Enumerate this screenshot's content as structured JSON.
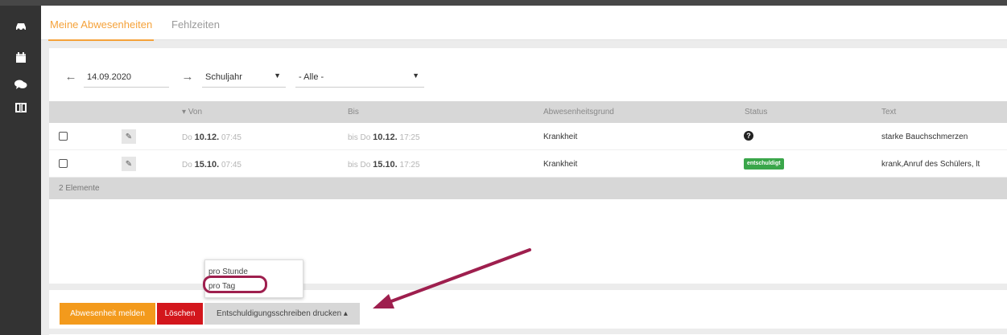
{
  "sidebar": {
    "items": [
      {
        "name": "dashboard-icon",
        "glyph": "🚗"
      },
      {
        "name": "calendar-icon",
        "glyph": "▦"
      },
      {
        "name": "messages-icon",
        "glyph": "💬"
      },
      {
        "name": "book-icon",
        "glyph": "▯"
      }
    ]
  },
  "tabs": {
    "active": "Meine Abwesenheiten",
    "inactive": "Fehlzeiten"
  },
  "filters": {
    "date_value": "14.09.2020",
    "prev_arrow": "←",
    "next_arrow": "→",
    "period_select": "Schuljahr",
    "filter_select": "- Alle -"
  },
  "table": {
    "headers": {
      "von": "Von",
      "bis": "Bis",
      "grund": "Abwesenheitsgrund",
      "status": "Status",
      "text": "Text"
    },
    "rows": [
      {
        "von_day": "Do",
        "von_date": "10.12.",
        "von_time": "07:45",
        "bis_prefix": "bis Do",
        "bis_date": "10.12.",
        "bis_time": "17:25",
        "grund": "Krankheit",
        "status_type": "unknown",
        "status_text": "?",
        "text": "starke Bauchschmerzen"
      },
      {
        "von_day": "Do",
        "von_date": "15.10.",
        "von_time": "07:45",
        "bis_prefix": "bis Do",
        "bis_date": "15.10.",
        "bis_time": "17:25",
        "grund": "Krankheit",
        "status_type": "excused",
        "status_text": "entschuldigt",
        "text": "krank,Anruf des Schülers, lt"
      }
    ],
    "footer": "2 Elemente"
  },
  "buttons": {
    "report": "Abwesenheit melden",
    "delete": "Löschen",
    "print": "Entschuldigungsschreiben drucken ▴"
  },
  "dropdown": {
    "items": [
      "pro Stunde",
      "pro Tag"
    ]
  },
  "colors": {
    "accent": "#f5a23a",
    "orange_button": "#f39a1c",
    "red_button": "#d3161c",
    "badge_green": "#3aa64a",
    "annotation": "#9e1f4e"
  }
}
